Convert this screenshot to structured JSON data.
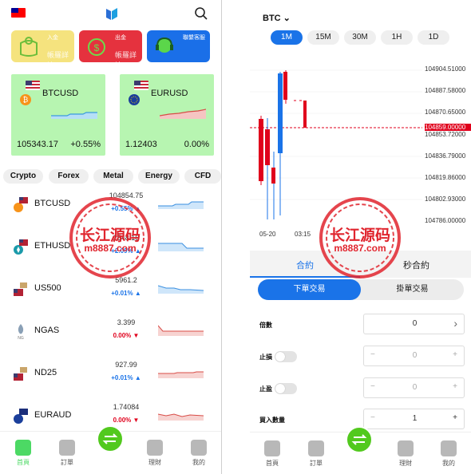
{
  "left": {
    "actions": [
      {
        "title": "入金",
        "sub": "帳羅詳情",
        "color": "#f5e37e"
      },
      {
        "title": "出金",
        "sub": "帳羅詳情",
        "color": "#e5323e"
      },
      {
        "title": "聯繫客服",
        "sub": "",
        "color": "#1a6fe8"
      }
    ],
    "cards": [
      {
        "name": "BTCUSD",
        "price": "105343.17",
        "pct": "+0.55%"
      },
      {
        "name": "EURUSD",
        "price": "1.12403",
        "pct": "0.00%"
      }
    ],
    "categories": [
      "Crypto",
      "Forex",
      "Metal",
      "Energy",
      "CFD"
    ],
    "rows": [
      {
        "symbol": "BTCUSD",
        "price": "104854.75",
        "change": "+0.55%",
        "dir": "up",
        "icon": "bitcoin-icon"
      },
      {
        "symbol": "ETHUSD",
        "price": "2548.15",
        "change": "+2.09%",
        "dir": "up",
        "icon": "ethereum-icon"
      },
      {
        "symbol": "US500",
        "price": "5961.2",
        "change": "+0.01%",
        "dir": "up",
        "icon": "us-flag-icon"
      },
      {
        "symbol": "NGAS",
        "price": "3.399",
        "change": "0.00%",
        "dir": "down",
        "icon": "gas-icon"
      },
      {
        "symbol": "ND25",
        "price": "927.99",
        "change": "+0.01%",
        "dir": "up",
        "icon": "us-flag-icon"
      },
      {
        "symbol": "EURAUD",
        "price": "1.74084",
        "change": "0.00%",
        "dir": "down",
        "icon": "eu-flag-icon"
      }
    ],
    "tabs": [
      {
        "label": "首頁",
        "active": true
      },
      {
        "label": "訂單",
        "active": false
      },
      {
        "label": "",
        "active": false
      },
      {
        "label": "理財",
        "active": false
      },
      {
        "label": "我的",
        "active": false
      }
    ]
  },
  "right": {
    "symbol": "BTC",
    "timeframes": [
      "1M",
      "15M",
      "30M",
      "1H",
      "1D"
    ],
    "active_timeframe": "1M",
    "price_axis": [
      "104904.51000",
      "104887.58000",
      "104870.65000",
      "104859.00000",
      "104853.72000",
      "104836.79000",
      "104819.86000",
      "104802.93000",
      "104786.00000"
    ],
    "time_axis": [
      "05-20",
      "03:15"
    ],
    "current_price": "104859.00000",
    "subtabs": [
      "合約",
      "秒合約"
    ],
    "order_tabs": [
      "下單交易",
      "掛單交易"
    ],
    "fields": [
      {
        "label": "倍數",
        "value": "0"
      },
      {
        "label": "止損",
        "value": "0"
      },
      {
        "label": "止盈",
        "value": "0"
      },
      {
        "label": "買入數量",
        "value": "1"
      }
    ],
    "tabs": [
      {
        "label": "首頁"
      },
      {
        "label": "訂單"
      },
      {
        "label": ""
      },
      {
        "label": "理財"
      },
      {
        "label": "我的"
      }
    ]
  },
  "watermark": {
    "text": "长江源码",
    "url": "m8887.com"
  },
  "colors": {
    "accent": "#1a73e8",
    "green": "#52c91e",
    "up": "#1a73e8",
    "down": "#e0001c",
    "card_bg": "#b7f5b1"
  }
}
